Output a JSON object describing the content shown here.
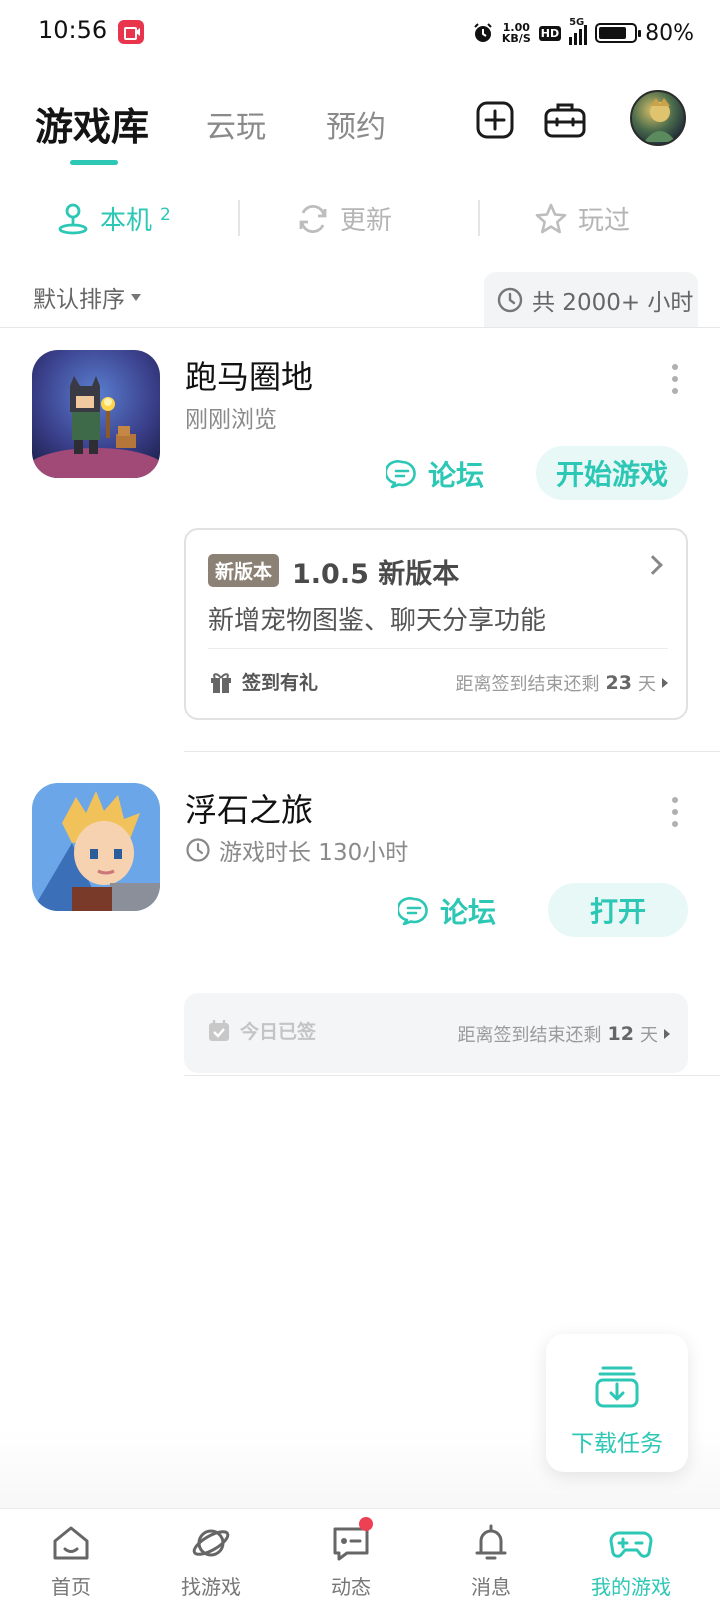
{
  "status_bar": {
    "time": "10:56",
    "net_speed_value": "1.00",
    "net_speed_unit": "KB/S",
    "hd": "HD",
    "network": "5G",
    "battery": "80%",
    "battery_level": 0.8
  },
  "header": {
    "tabs": [
      {
        "label": "游戏库",
        "active": true
      },
      {
        "label": "云玩",
        "active": false
      },
      {
        "label": "预约",
        "active": false
      }
    ],
    "icons": [
      "add-square-icon",
      "toolbox-icon"
    ]
  },
  "subtabs": [
    {
      "label": "本机",
      "count": "2",
      "icon": "location-person-icon",
      "active": true
    },
    {
      "label": "更新",
      "icon": "refresh-icon",
      "active": false
    },
    {
      "label": "玩过",
      "icon": "star-icon",
      "active": false
    }
  ],
  "sort": {
    "label": "默认排序",
    "hours": "共 2000+ 小时"
  },
  "games": [
    {
      "title": "跑马圈地",
      "subtitle": "刚刚浏览",
      "forum_label": "论坛",
      "primary_label": "开始游戏",
      "update": {
        "badge": "新版本",
        "title": "1.0.5 新版本",
        "desc": "新增宠物图鉴、聊天分享功能",
        "sign_label": "签到有礼",
        "sign_remaining_prefix": "距离签到结束还剩",
        "sign_remaining_days": "23",
        "sign_remaining_unit": "天"
      }
    },
    {
      "title": "浮石之旅",
      "subtitle": "游戏时长 130小时",
      "forum_label": "论坛",
      "primary_label": "打开",
      "signed": {
        "label": "今日已签",
        "remaining_prefix": "距离签到结束还剩",
        "remaining_days": "12",
        "remaining_unit": "天"
      }
    }
  ],
  "download_task": {
    "label": "下载任务"
  },
  "bottom_nav": [
    {
      "label": "首页",
      "icon": "home-icon",
      "active": false
    },
    {
      "label": "找游戏",
      "icon": "planet-icon",
      "active": false
    },
    {
      "label": "动态",
      "icon": "chat-icon",
      "active": false
    },
    {
      "label": "消息",
      "icon": "bell-icon",
      "active": false
    },
    {
      "label": "我的游戏",
      "icon": "gamepad-icon",
      "active": true
    }
  ],
  "colors": {
    "accent": "#2cc7b5",
    "accent_light": "#e7f8f6",
    "badge": "#8b8174",
    "notification": "#ee4055"
  }
}
